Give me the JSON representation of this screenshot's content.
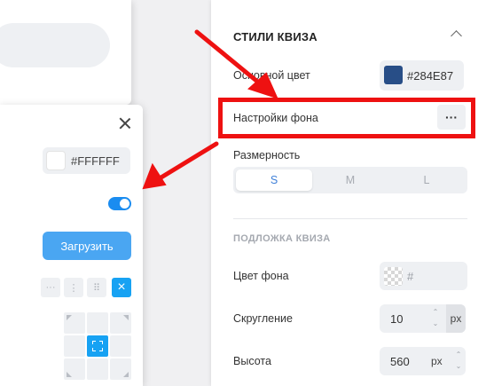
{
  "popup": {
    "background_hex": "#FFFFFF",
    "toggle_on": true,
    "upload_label": "Загрузить",
    "tools": [
      "···",
      "⋮",
      "⠿",
      "×"
    ]
  },
  "styles_panel": {
    "title": "СТИЛИ КВИЗА",
    "main_color": {
      "label": "Основной цвет",
      "value": "#284E87",
      "color": "#284E87"
    },
    "background_settings": {
      "label": "Настройки фона",
      "more": "···"
    },
    "size": {
      "label": "Размерность",
      "options": [
        "S",
        "M",
        "L"
      ],
      "selected": "S"
    },
    "substrate": {
      "title": "ПОДЛОЖКА КВИЗА",
      "bg_color": {
        "label": "Цвет фона",
        "value": "#"
      },
      "rounding": {
        "label": "Скругление",
        "value": "10",
        "unit": "px"
      },
      "height": {
        "label": "Высота",
        "value": "560",
        "unit": "px"
      }
    }
  },
  "colors": {
    "accent": "#17A2F3",
    "annotation": "#EE1111"
  }
}
